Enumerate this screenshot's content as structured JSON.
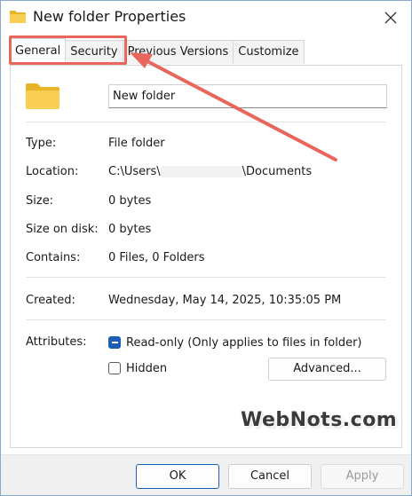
{
  "window": {
    "title": "New folder Properties",
    "folder_icon": "folder-icon",
    "close_icon": "close-icon"
  },
  "tabs": [
    {
      "label": "General",
      "active": true
    },
    {
      "label": "Security",
      "active": false
    },
    {
      "label": "Previous Versions",
      "active": false
    },
    {
      "label": "Customize",
      "active": false
    }
  ],
  "general": {
    "name_value": "New folder",
    "type_label": "Type:",
    "type_value": "File folder",
    "location_label": "Location:",
    "location_prefix": "C:\\Users\\",
    "location_suffix": "\\Documents",
    "size_label": "Size:",
    "size_value": "0 bytes",
    "size_on_disk_label": "Size on disk:",
    "size_on_disk_value": "0 bytes",
    "contains_label": "Contains:",
    "contains_value": "0 Files, 0 Folders",
    "created_label": "Created:",
    "created_value": "Wednesday, May 14, 2025, 10:35:05 PM",
    "attributes_label": "Attributes:",
    "readonly_label": "Read-only (Only applies to files in folder)",
    "readonly_state": "indeterminate",
    "hidden_label": "Hidden",
    "hidden_state": "unchecked",
    "advanced_label": "Advanced..."
  },
  "watermark": "WebNots.com",
  "footer": {
    "ok_label": "OK",
    "cancel_label": "Cancel",
    "apply_label": "Apply"
  },
  "colors": {
    "highlight": "#e8665c",
    "accent": "#1a5fb4",
    "folder": "#f5c542"
  }
}
